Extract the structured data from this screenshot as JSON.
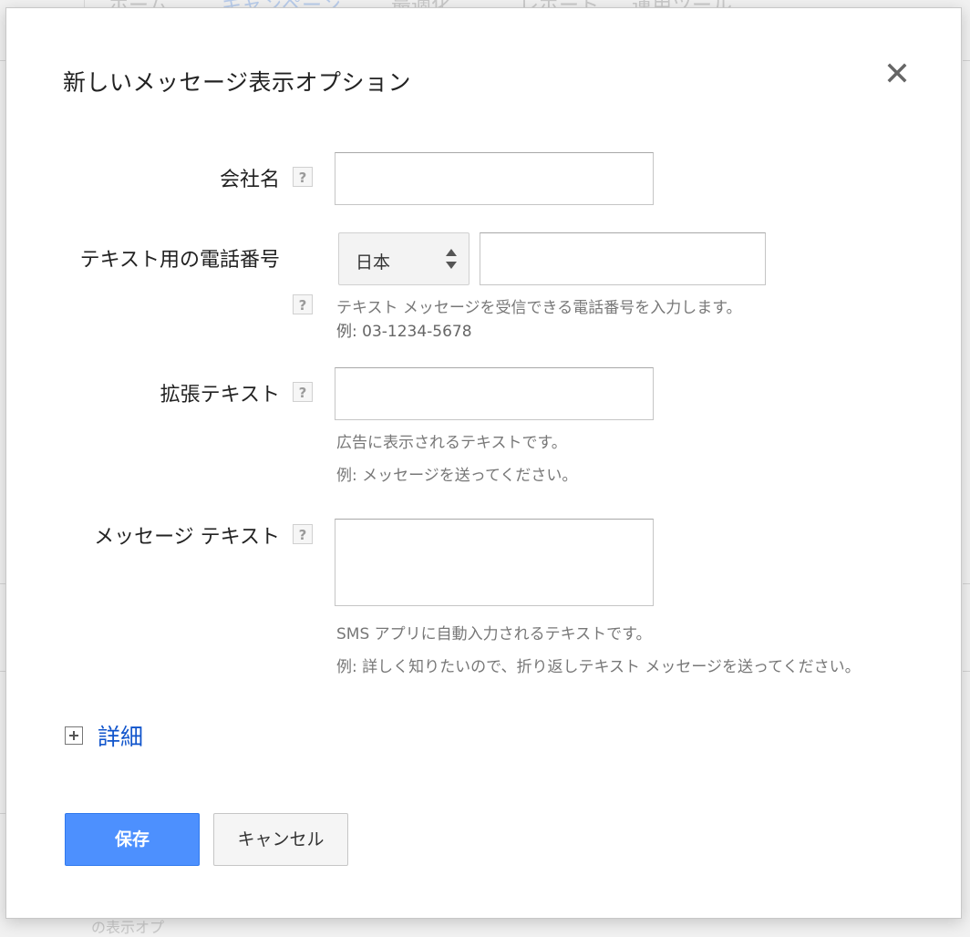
{
  "background": {
    "nav_items": [
      "ホーム",
      "キャンペーン",
      "最適化",
      "レポート",
      "運用ツール"
    ],
    "bottom_text": "の表示オプ"
  },
  "dialog": {
    "title": "新しいメッセージ表示オプション",
    "close_icon": "close-icon"
  },
  "form": {
    "company": {
      "label": "会社名",
      "help": "?",
      "value": ""
    },
    "phone": {
      "label": "テキスト用の電話番号",
      "country": "日本",
      "value": "",
      "help": "?",
      "hint": "テキスト メッセージを受信できる電話番号を入力します。",
      "example": "例: 03-1234-5678"
    },
    "extension": {
      "label": "拡張テキスト",
      "help": "?",
      "value": "",
      "hint": "広告に表示されるテキストです。",
      "example": "例: メッセージを送ってください。"
    },
    "message": {
      "label": "メッセージ テキスト",
      "help": "?",
      "value": "",
      "hint": "SMS アプリに自動入力されるテキストです。",
      "example": "例: 詳しく知りたいので、折り返しテキスト メッセージを送ってください。"
    }
  },
  "details": {
    "label": "詳細"
  },
  "buttons": {
    "save": "保存",
    "cancel": "キャンセル"
  },
  "colors": {
    "primary": "#4d90fe",
    "link": "#1155cc"
  }
}
